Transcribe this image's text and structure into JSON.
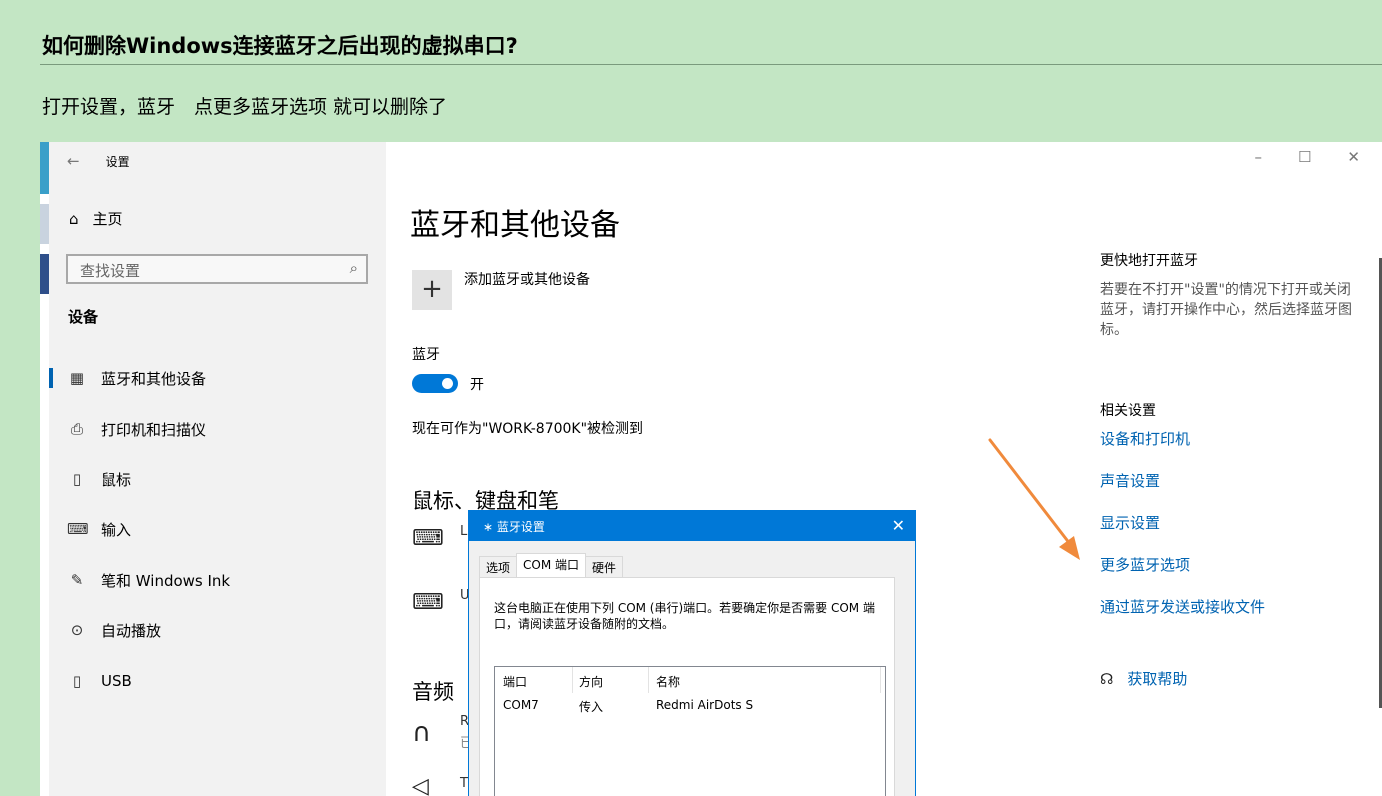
{
  "article": {
    "title": "如何删除Windows连接蓝牙之后出现的虚拟串口?",
    "subtitle": "打开设置，蓝牙　点更多蓝牙选项 就可以删除了"
  },
  "settings": {
    "window_title": "设置",
    "back_icon": "back-arrow-icon",
    "window_controls": [
      "–",
      "☐",
      "✕"
    ],
    "sidebar": {
      "home_label": "主页",
      "search_placeholder": "查找设置",
      "section_title": "设备",
      "items": [
        {
          "label": "蓝牙和其他设备",
          "icon": "bluetooth-devices-icon",
          "active": true
        },
        {
          "label": "打印机和扫描仪",
          "icon": "printer-icon",
          "active": false
        },
        {
          "label": "鼠标",
          "icon": "mouse-icon",
          "active": false
        },
        {
          "label": "输入",
          "icon": "keyboard-icon",
          "active": false
        },
        {
          "label": "笔和 Windows Ink",
          "icon": "pen-icon",
          "active": false
        },
        {
          "label": "自动播放",
          "icon": "autoplay-icon",
          "active": false
        },
        {
          "label": "USB",
          "icon": "usb-icon",
          "active": false
        }
      ]
    },
    "main": {
      "page_title": "蓝牙和其他设备",
      "add_device_label": "添加蓝牙或其他设备",
      "bluetooth_label": "蓝牙",
      "toggle_state": "开",
      "toggle_on": true,
      "discoverable_text": "现在可作为\"WORK-8700K\"被检测到",
      "section_mouse": "鼠标、键盘和笔",
      "section_audio": "音频",
      "device_stubs": [
        "L",
        "U",
        "R",
        "已",
        "T"
      ]
    },
    "related": {
      "quick_title": "更快地打开蓝牙",
      "quick_text": "若要在不打开\"设置\"的情况下打开或关闭蓝牙，请打开操作中心，然后选择蓝牙图标。",
      "related_title": "相关设置",
      "links": [
        "设备和打印机",
        "声音设置",
        "显示设置",
        "更多蓝牙选项",
        "通过蓝牙发送或接收文件"
      ],
      "help_label": "获取帮助"
    }
  },
  "dialog": {
    "title": "蓝牙设置",
    "tabs": [
      "选项",
      "COM 端口",
      "硬件"
    ],
    "selected_tab": "COM 端口",
    "description": "这台电脑正在使用下列 COM (串行)端口。若要确定你是否需要 COM 端口，请阅读蓝牙设备随附的文档。",
    "columns": [
      "端口",
      "方向",
      "名称"
    ],
    "rows": [
      {
        "port": "COM7",
        "direction": "传入",
        "name": "Redmi AirDots S"
      }
    ]
  },
  "colors": {
    "background": "#c3e6c4",
    "accent": "#0078d7",
    "link": "#0063b1",
    "arrow": "#f08a3c"
  }
}
